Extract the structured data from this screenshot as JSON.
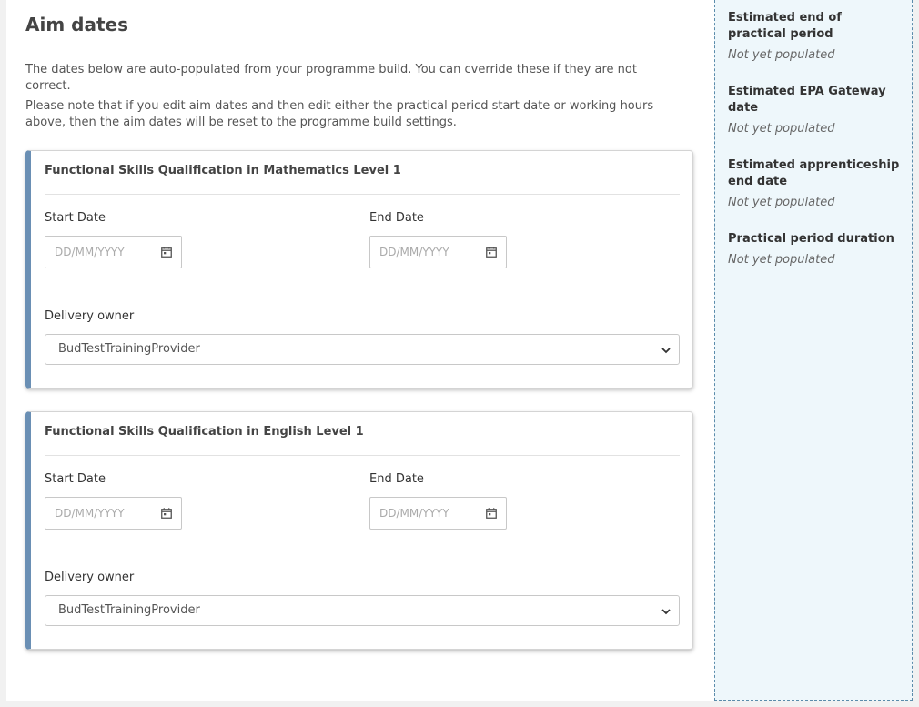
{
  "section": {
    "title": "Aim dates",
    "intro": "The dates below are auto-populated from your programme build. You can cverride these if they are not correct.",
    "note": "Please note that if you edit aim dates and then edit either the practical pericd start date or working hours above, then the aim dates will be reset to the programme build settings."
  },
  "aims": [
    {
      "title": "Functional Skills Qualification in Mathematics Level 1",
      "start_label": "Start Date",
      "start_placeholder": "DD/MM/YYYY",
      "end_label": "End Date",
      "end_placeholder": "DD/MM/YYYY",
      "owner_label": "Delivery owner",
      "owner_value": "BudTestTrainingProvider"
    },
    {
      "title": "Functional Skills Qualification in English Level 1",
      "start_label": "Start Date",
      "start_placeholder": "DD/MM/YYYY",
      "end_label": "End Date",
      "end_placeholder": "DD/MM/YYYY",
      "owner_label": "Delivery owner",
      "owner_value": "BudTestTrainingProvider"
    }
  ],
  "sidebar": {
    "items": [
      {
        "label": "Estimated end of practical period",
        "value": "Not yet populated"
      },
      {
        "label": "Estimated EPA Gateway date",
        "value": "Not yet populated"
      },
      {
        "label": "Estimated apprenticeship end date",
        "value": "Not yet populated"
      },
      {
        "label": "Practical period duration",
        "value": "Not yet populated"
      }
    ]
  },
  "icons": {
    "date_picker": "calendar-icon",
    "select_toggle": "chevron-down-icon"
  },
  "colors": {
    "card_accent": "#6a8fb4",
    "sidebar_bg": "#eef7fb",
    "sidebar_border": "#5b8cab"
  }
}
